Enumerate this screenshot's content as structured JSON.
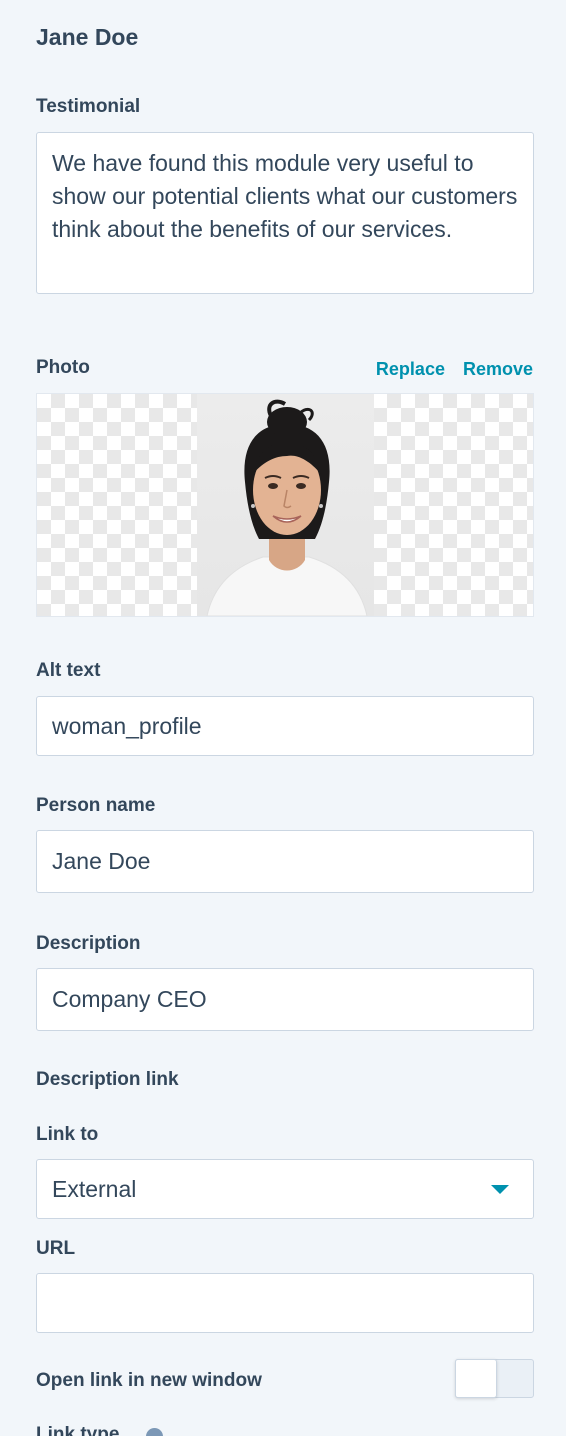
{
  "module": {
    "title": "Jane Doe"
  },
  "testimonial": {
    "label": "Testimonial",
    "value": "We have found this module very useful to show our potential clients what our customers think about the benefits of our services."
  },
  "photo": {
    "label": "Photo",
    "replace_label": "Replace",
    "remove_label": "Remove"
  },
  "alt_text": {
    "label": "Alt text",
    "value": "woman_profile"
  },
  "person_name": {
    "label": "Person name",
    "value": "Jane Doe"
  },
  "description": {
    "label": "Description",
    "value": "Company CEO"
  },
  "description_link": {
    "heading": "Description link",
    "link_to_label": "Link to",
    "link_to_value": "External",
    "url_label": "URL",
    "url_value": "",
    "open_new_window_label": "Open link in new window",
    "open_new_window_on": false,
    "link_type_label": "Link type"
  },
  "colors": {
    "accent": "#0091ae",
    "text": "#33475b",
    "border": "#cbd6e2",
    "background": "#f2f6fa"
  },
  "icons": {
    "dropdown": "caret-down-icon",
    "info": "info-icon"
  }
}
